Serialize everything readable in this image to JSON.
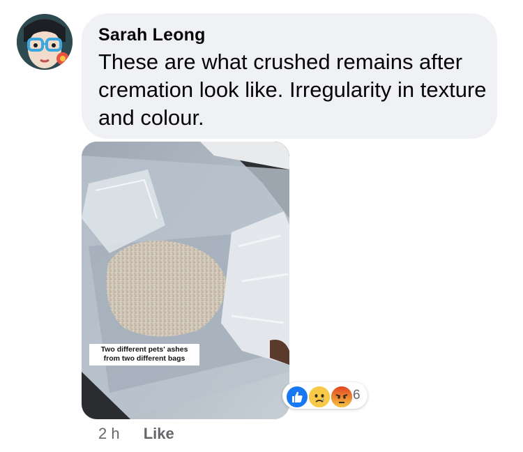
{
  "comment": {
    "author": "Sarah Leong",
    "text": "These are what crushed remains after cremation look like. Irregularity in texture and colour.",
    "photo": {
      "caption_line1": "Two different pets' ashes",
      "caption_line2": "from two different bags"
    },
    "reactions": {
      "icons": [
        "like-icon",
        "sad-icon",
        "angry-icon"
      ],
      "count": "6"
    },
    "timestamp": "2 h",
    "like_label": "Like"
  },
  "colors": {
    "bubble": "#eff1f4",
    "text": "#050505",
    "meta": "#65676b",
    "like_blue": "#1877f2"
  }
}
